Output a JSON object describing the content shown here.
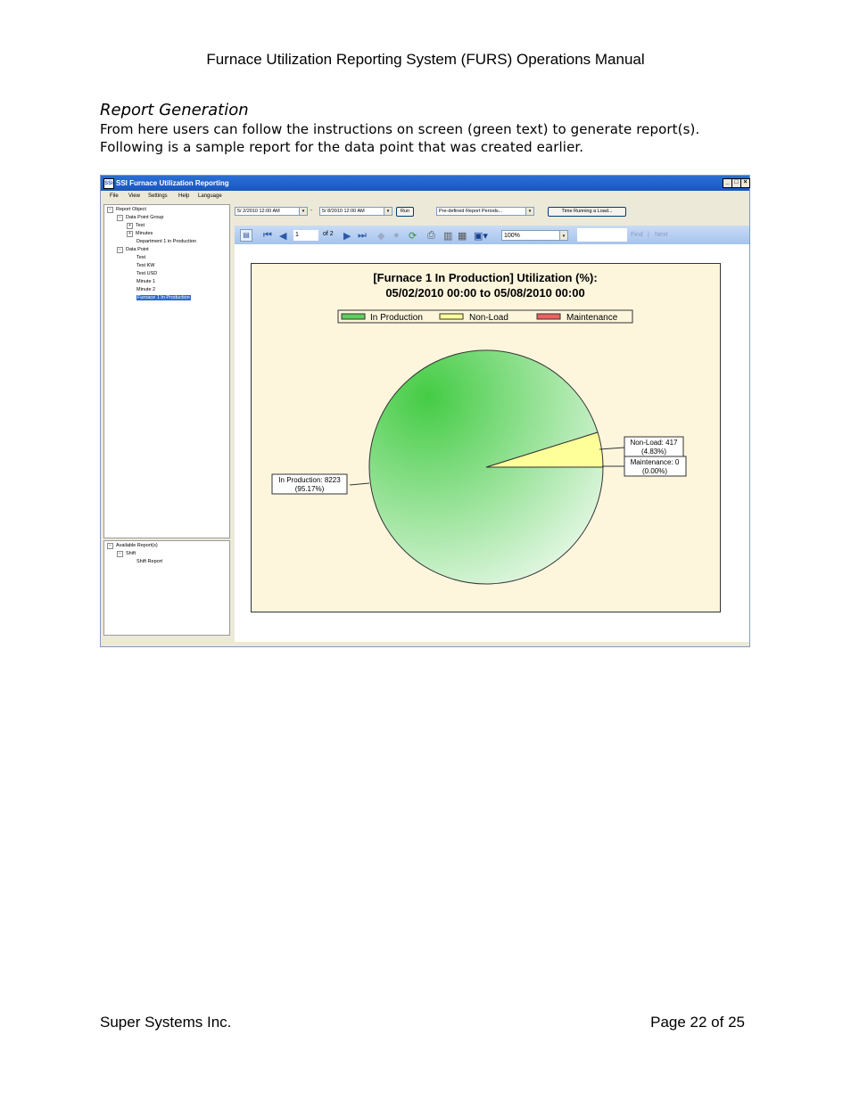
{
  "document": {
    "header": "Furnace Utilization Reporting System (FURS) Operations Manual",
    "section_title": "Report Generation",
    "paragraph_line1": "From here users can follow the instructions on screen (green text) to generate report(s).",
    "paragraph_line2": "Following is a sample report for the data point that was created earlier.",
    "footer_left": "Super Systems Inc.",
    "footer_right": "Page 22 of 25"
  },
  "window": {
    "app_icon": "SSi",
    "title": "SSI Furnace Utilization Reporting",
    "min_label": "_",
    "max_label": "□",
    "close_label": "×",
    "menu": [
      "File",
      "View",
      "Settings",
      "Help",
      "Language"
    ]
  },
  "tree": {
    "root": "Report Object",
    "group": "Data Point Group",
    "group_items": [
      "Test",
      "Minutes",
      "Department 1 in Production"
    ],
    "datapoint": "Data Point",
    "datapoint_items": [
      "Test",
      "Test KW",
      "Test USD",
      "Minute 1",
      "Minute 2"
    ],
    "selected": "Furnace 1 In Production"
  },
  "reports_tree": {
    "root": "Available Report(s)",
    "shift": "Shift",
    "shift_report": "Shift Report"
  },
  "controls": {
    "start_date": "5/ 2/2010 12:00 AM",
    "dash": "-",
    "end_date": "5/ 8/2010 12:00 AM",
    "run_label": "Run",
    "period_select": "Pre-defined Report Periods...",
    "time_running_label": "Time Running a Load..."
  },
  "viewer": {
    "page_input": "1",
    "of_pages": "of  2",
    "zoom": "100%",
    "find_label": "Find",
    "sep": "|",
    "next_label": "Next"
  },
  "icons": [
    "toggle-tree-icon",
    "first-page-icon",
    "prev-page-icon",
    "next-page-icon",
    "last-page-icon",
    "back-icon",
    "stop-icon",
    "refresh-icon",
    "print-icon",
    "print-layout-icon",
    "page-setup-icon",
    "export-icon"
  ],
  "chart_data": {
    "type": "pie",
    "title": "[Furnace 1 In Production] Utilization (%):",
    "subtitle": "05/02/2010 00:00 to 05/08/2010 00:00",
    "legend": [
      "In Production",
      "Non-Load",
      "Maintenance"
    ],
    "legend_placement": "top",
    "slices": [
      {
        "name": "In Production",
        "value": 8223,
        "percent": "95.17%",
        "label": "In Production: 8223",
        "sublabel": "(95.17%)",
        "color": "#5ccf5c"
      },
      {
        "name": "Non-Load",
        "value": 417,
        "percent": "4.83%",
        "label": "Non-Load: 417",
        "sublabel": "(4.83%)",
        "color": "#ffff99"
      },
      {
        "name": "Maintenance",
        "value": 0,
        "percent": "0.00%",
        "label": "Maintenance: 0",
        "sublabel": "(0.00%)",
        "color": "#f06060"
      }
    ]
  }
}
